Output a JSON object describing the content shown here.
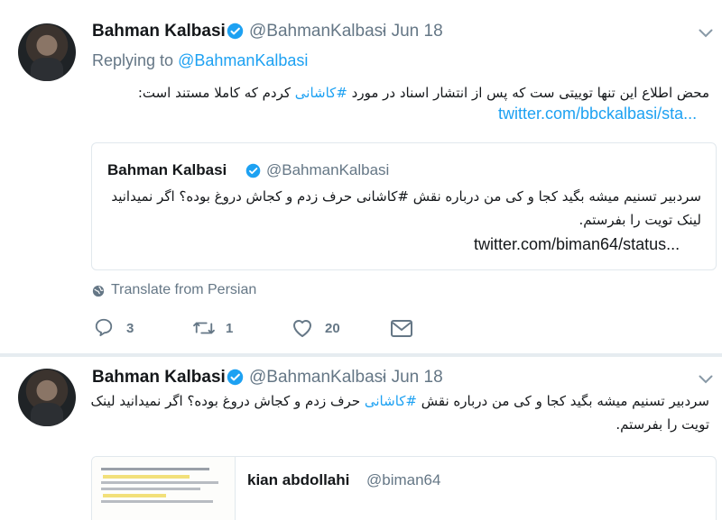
{
  "tweet1": {
    "name": "Bahman Kalbasi",
    "handle": "@BahmanKalbasi",
    "date": "· Jun 18",
    "replying_prefix": "Replying to",
    "replying_to": "@BahmanKalbasi",
    "text_before": "محض اطلاع این تنها توییتی ست که پس از انتشار اسناد در مورد ",
    "hashtag": "#کاشانی",
    "text_after": " کردم که کاملا مستند است:",
    "link": "twitter.com/bbckalbasi/sta...",
    "quote": {
      "name": "Bahman Kalbasi",
      "handle": "@BahmanKalbasi",
      "line1_before": "سردبیر تسنیم میشه بگید کجا و کی من درباره نقش ",
      "hashtag": "#کاشانی",
      "line1_after": " حرف زدم و کجاش دروغ بوده؟ اگر نمیدانید",
      "line2": "لینک تویت را بفرستم.",
      "link": "twitter.com/biman64/status..."
    },
    "translate": "Translate from Persian",
    "reply_count": "3",
    "retweet_count": "1",
    "like_count": "20"
  },
  "tweet2": {
    "name": "Bahman Kalbasi",
    "handle": "@BahmanKalbasi",
    "date": "· Jun 18",
    "line1_before": "سردبیر تسنیم میشه بگید کجا و کی من درباره نقش ",
    "hashtag": "#کاشانی",
    "line1_after": " حرف زدم و کجاش دروغ بوده؟ اگر نمیدانید لینک",
    "line2": "تویت را بفرستم.",
    "quote": {
      "name": "kian abdollahi",
      "handle": "@biman64"
    }
  },
  "colors": {
    "link": "#1da1f2",
    "secondary_text": "#657786",
    "border": "#e1e8ed"
  },
  "icons": [
    "chevron-down-icon",
    "verified-badge-icon",
    "globe-icon",
    "reply-icon",
    "retweet-icon",
    "heart-icon",
    "direct-message-icon"
  ]
}
